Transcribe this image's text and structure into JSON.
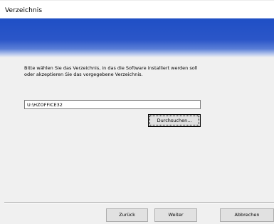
{
  "window": {
    "title": "Verzeichnis"
  },
  "instruction": {
    "line1": "Bitte wählen Sie das Verzeichnis, in das die Software installiert werden soll",
    "line2": "oder akzeptieren Sie das vorgegebene Verzeichnis."
  },
  "path_input": {
    "value": "U:\\HZOFFICE32"
  },
  "buttons": {
    "browse_label": "Durchsuchen...",
    "back_label": "Zurück",
    "next_label": "Weiter",
    "cancel_label": "Abbrechen"
  },
  "colors": {
    "banner": "#2b56c8",
    "dialog_background": "#f0f0f0"
  }
}
